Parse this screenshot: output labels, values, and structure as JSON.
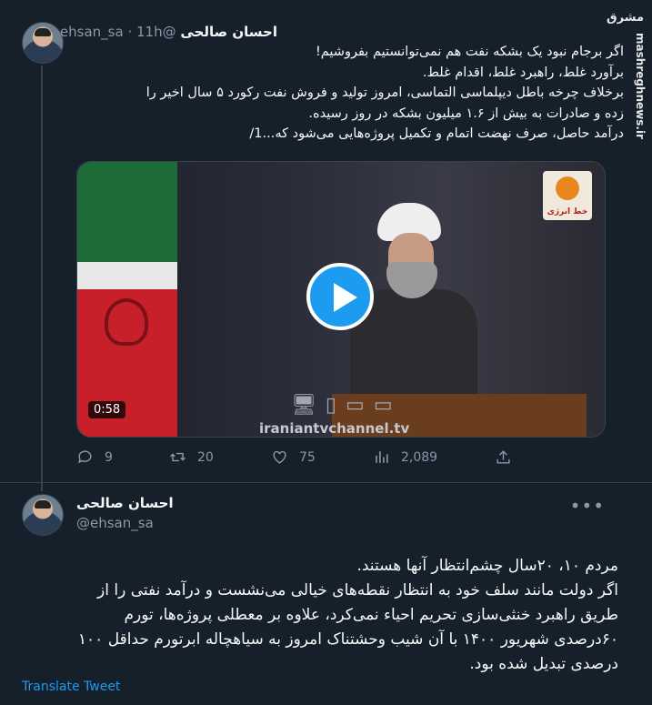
{
  "tweet1": {
    "author_name": "احسان صالحی",
    "author_handle": "@ehsan_sa",
    "separator": "·",
    "time": "11h",
    "lines": [
      "اگر برجام نبود یک بشکه نفت هم نمی‌توانستیم بفروشیم!",
      "برآورد غلط، راهبرد غلط، اقدام غلط.",
      "برخلاف چرخه باطل دیپلماسی التماسی، امروز تولید و فروش نفت رکورد ۵ سال اخیر را",
      "زده و صادرات به بیش از ۱.۶ میلیون بشکه در روز رسیده.",
      "درآمد حاصل، صرف نهضت اتمام و تکمیل پروژه‌هایی می‌شود که...1/"
    ],
    "video": {
      "duration": "0:58",
      "watermark": "iraniantvchannel.tv",
      "logo_text": "خط انرژی"
    },
    "actions": {
      "replies": "9",
      "retweets": "20",
      "likes": "75",
      "views": "2,089"
    }
  },
  "tweet2": {
    "author_name": "احسان صالحی",
    "author_handle": "@ehsan_sa",
    "more": "•••",
    "lines": [
      "مردم ۱۰، ۲۰سال چشم‌انتظار آنها هستند.",
      "اگر دولت مانند سلف خود به انتظار نقطه‌های خیالی می‌نشست و درآمد نفتی را از",
      "طریق راهبرد خنثی‌سازی تحریم احیاء نمی‌کرد، علاوه بر معطلی پروژه‌ها، تورم",
      "۶۰درصدی شهریور ۱۴۰۰ با آن شیب وحشتناک امروز به سیاهچاله ابرتورم حداقل ۱۰۰",
      "درصدی تبدیل شده بود."
    ],
    "translate_label": "Translate Tweet"
  },
  "watermark": {
    "site": "mashreghnews.ir",
    "logo": "مشرق"
  },
  "colors": {
    "background": "#15202b",
    "accent": "#1d9bf0",
    "muted": "#8b98a5"
  }
}
